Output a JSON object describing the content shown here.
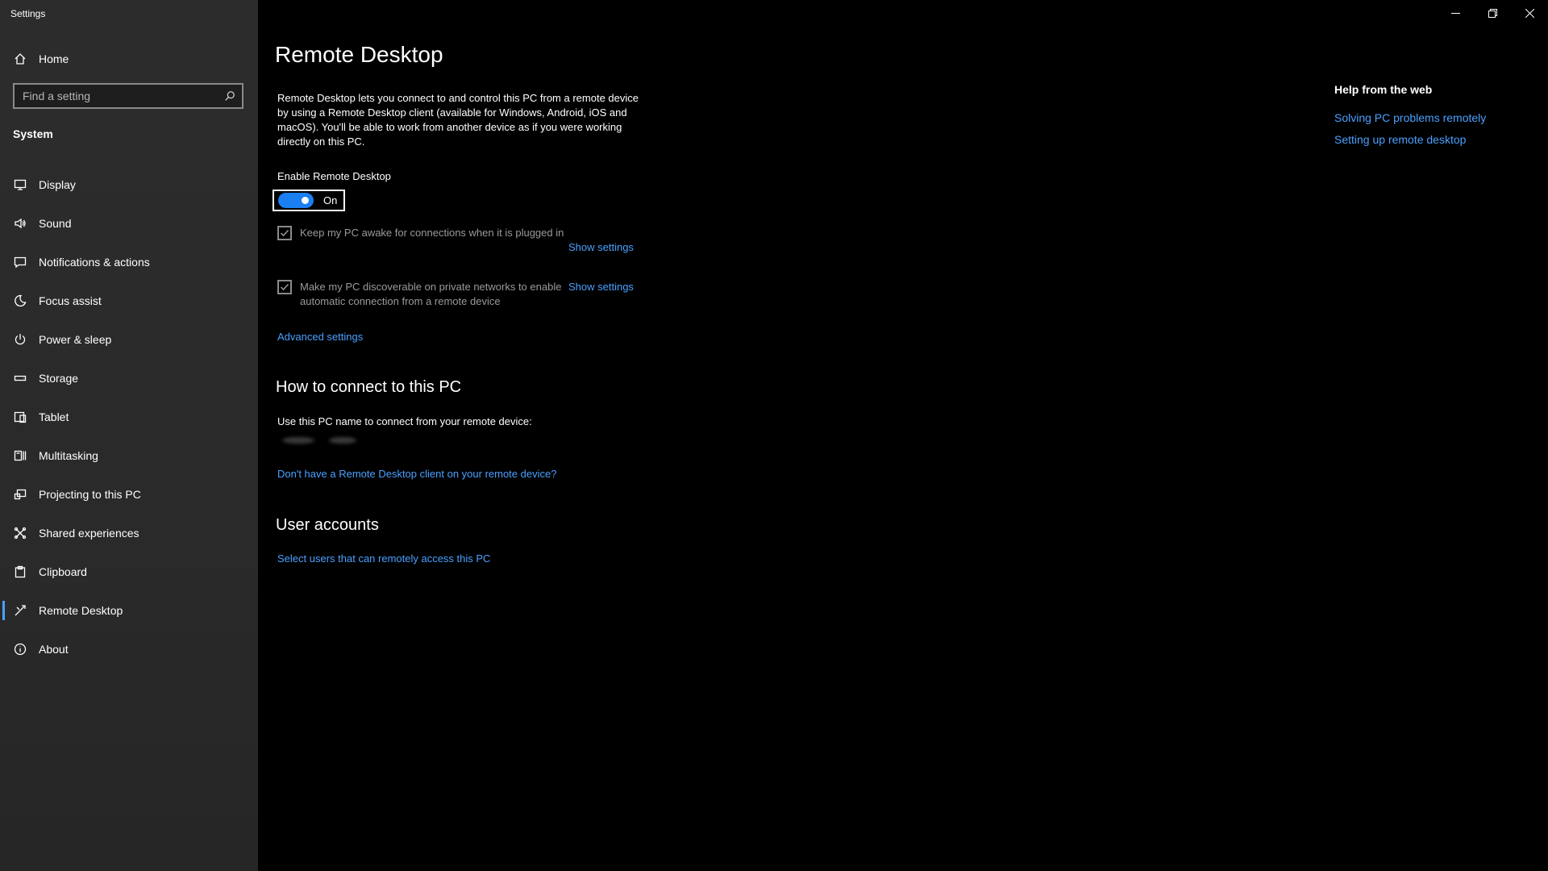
{
  "app": {
    "title": "Settings"
  },
  "sidebar": {
    "home_label": "Home",
    "search_placeholder": "Find a setting",
    "section_title": "System",
    "items": [
      {
        "label": "Display",
        "icon": "monitor-icon"
      },
      {
        "label": "Sound",
        "icon": "speaker-icon"
      },
      {
        "label": "Notifications & actions",
        "icon": "notification-icon"
      },
      {
        "label": "Focus assist",
        "icon": "moon-icon"
      },
      {
        "label": "Power & sleep",
        "icon": "power-icon"
      },
      {
        "label": "Storage",
        "icon": "storage-icon"
      },
      {
        "label": "Tablet",
        "icon": "tablet-icon"
      },
      {
        "label": "Multitasking",
        "icon": "multitasking-icon"
      },
      {
        "label": "Projecting to this PC",
        "icon": "projector-icon"
      },
      {
        "label": "Shared experiences",
        "icon": "shared-icon"
      },
      {
        "label": "Clipboard",
        "icon": "clipboard-icon"
      },
      {
        "label": "Remote Desktop",
        "icon": "remote-desktop-icon",
        "selected": true
      },
      {
        "label": "About",
        "icon": "info-icon"
      }
    ]
  },
  "main": {
    "title": "Remote Desktop",
    "description": "Remote Desktop lets you connect to and control this PC from a remote device by using a Remote Desktop client (available for Windows, Android, iOS and macOS). You'll be able to work from another device as if you were working directly on this PC.",
    "enable_label": "Enable Remote Desktop",
    "toggle_state": "On",
    "options": [
      {
        "text": "Keep my PC awake for connections when it is plugged in",
        "link": "Show settings",
        "checked": true
      },
      {
        "text": "Make my PC discoverable on private networks to enable automatic connection from a remote device",
        "link": "Show settings",
        "checked": true
      }
    ],
    "advanced_link": "Advanced settings",
    "connect_heading": "How to connect to this PC",
    "connect_text": "Use this PC name to connect from your remote device:",
    "client_link": "Don't have a Remote Desktop client on your remote device?",
    "accounts_heading": "User accounts",
    "accounts_link": "Select users that can remotely access this PC"
  },
  "help": {
    "title": "Help from the web",
    "links": [
      "Solving PC problems remotely",
      "Setting up remote desktop"
    ]
  },
  "colors": {
    "accent": "#1a7ff0",
    "link": "#4aa0ff",
    "sidebar_bg": "#2b2b2b",
    "main_bg": "#000000"
  }
}
